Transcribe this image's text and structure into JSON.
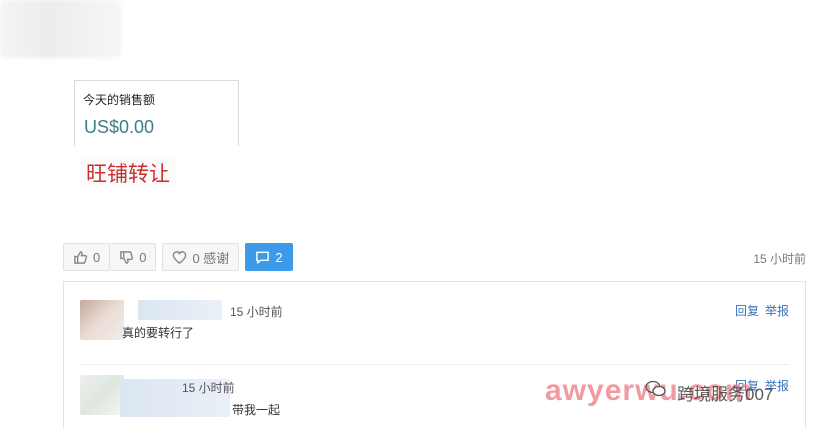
{
  "sales_card": {
    "title": "今天的销售额",
    "value": "US$0.00"
  },
  "post": {
    "title": "旺铺转让",
    "time": "15 小时前"
  },
  "actions": {
    "like_count": "0",
    "dislike_count": "0",
    "thanks_label": "0 感谢",
    "comment_count": "2"
  },
  "comments": [
    {
      "time": "15 小时前",
      "text": "真的要转行了",
      "reply_label": "回复",
      "report_label": "举报"
    },
    {
      "time": "15 小时前",
      "text": "带我一起",
      "reply_label": "回复",
      "report_label": "举报"
    }
  ],
  "watermark": {
    "text": "awyerwu.com",
    "brand": "跨境服务007"
  },
  "colors": {
    "accent": "#3d9ae8",
    "title_red": "#c9302c",
    "sales_value": "#3b7f86",
    "link_blue": "#3873b8"
  },
  "icons": [
    "thumbs-up-icon",
    "thumbs-down-icon",
    "heart-icon",
    "comment-icon",
    "wechat-icon"
  ]
}
